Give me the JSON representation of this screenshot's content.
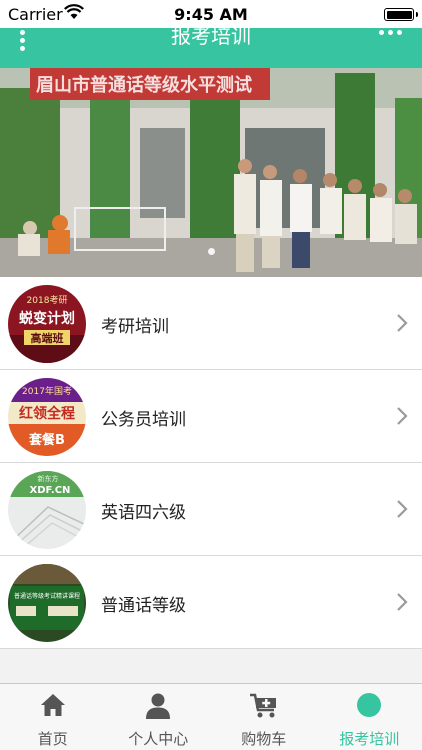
{
  "status_bar": {
    "carrier": "Carrier",
    "time": "9:45 AM"
  },
  "nav": {
    "title": "报考培训"
  },
  "banner": {
    "sign_text": "眉山市普通话等级水平测试"
  },
  "list": {
    "items": [
      {
        "label": "考研培训",
        "thumb_lines": [
          "2018考研",
          "蜕变计划",
          "高端班"
        ]
      },
      {
        "label": "公务员培训",
        "thumb_lines": [
          "2017年国考",
          "红领全程",
          "套餐B"
        ]
      },
      {
        "label": "英语四六级",
        "thumb_lines": [
          "新东方",
          "XDF.CN"
        ]
      },
      {
        "label": "普通话等级",
        "thumb_lines": [
          "普通话等级考试精讲课程"
        ]
      }
    ]
  },
  "tabbar": {
    "tabs": [
      {
        "label": "首页",
        "icon": "home-icon"
      },
      {
        "label": "个人中心",
        "icon": "person-icon"
      },
      {
        "label": "购物车",
        "icon": "cart-icon"
      },
      {
        "label": "报考培训",
        "icon": "dot-icon"
      }
    ],
    "active_index": 3
  },
  "colors": {
    "accent": "#36c5a0"
  }
}
